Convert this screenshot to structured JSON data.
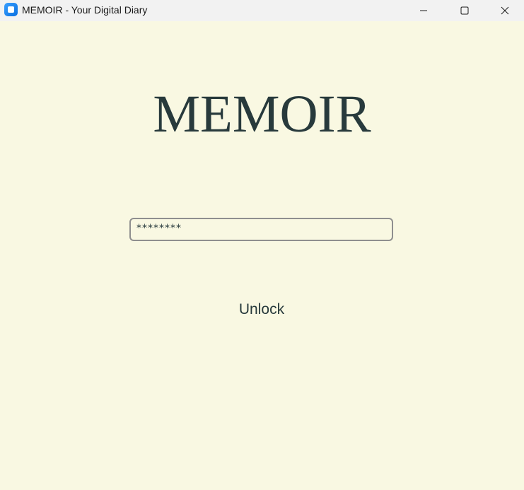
{
  "window": {
    "title": "MEMOIR - Your Digital Diary",
    "controls": [
      "minimize-icon",
      "maximize-icon",
      "close-icon"
    ]
  },
  "app": {
    "heading": "MEMOIR"
  },
  "password": {
    "value": "********"
  },
  "actions": {
    "unlock_label": "Unlock"
  },
  "colors": {
    "background": "#f9f8e2",
    "text": "#283a3c",
    "titlebar": "#f2f2f2",
    "field_border": "#8f8f8f",
    "app_icon": "#1a82f0"
  }
}
